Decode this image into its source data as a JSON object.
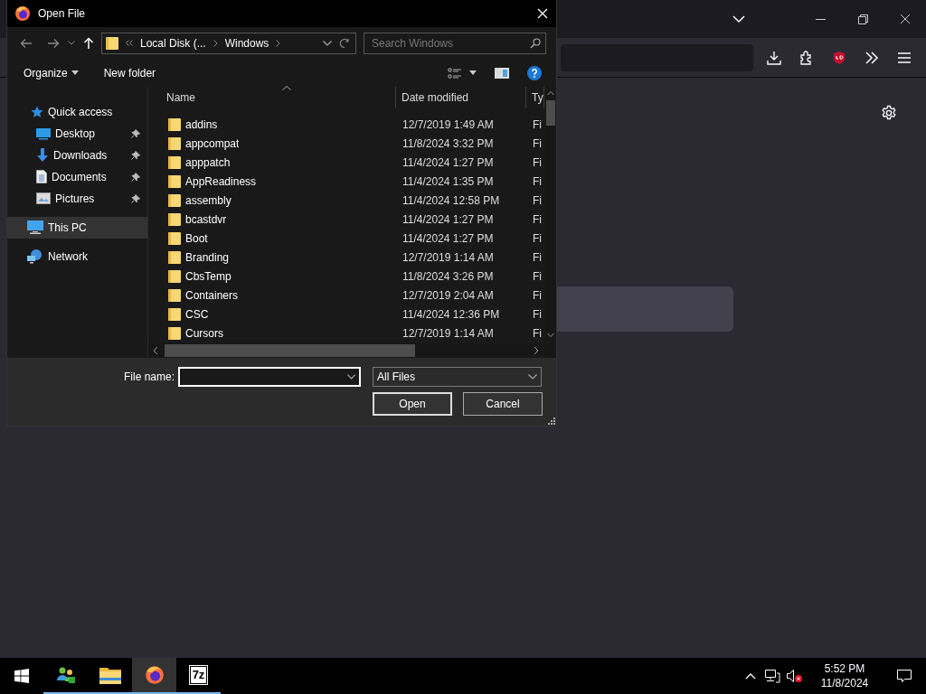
{
  "dialog": {
    "title": "Open File",
    "breadcrumb": [
      "Local Disk (...",
      "Windows"
    ],
    "search": {
      "placeholder": "Search Windows"
    },
    "toolbar": {
      "organize": "Organize",
      "new_folder": "New folder"
    },
    "nav": [
      {
        "label": "Quick access",
        "kind": "quick",
        "selected": false,
        "children": [
          {
            "label": "Desktop",
            "kind": "desktop",
            "selected": false,
            "pinned": true
          },
          {
            "label": "Downloads",
            "kind": "downloads",
            "selected": false,
            "pinned": true
          },
          {
            "label": "Documents",
            "kind": "documents",
            "selected": false,
            "pinned": true
          },
          {
            "label": "Pictures",
            "kind": "pictures",
            "selected": false,
            "pinned": true
          }
        ]
      },
      {
        "label": "This PC",
        "kind": "pc",
        "selected": true
      },
      {
        "label": "Network",
        "kind": "network",
        "selected": false
      }
    ],
    "columns": [
      "Name",
      "Date modified",
      "Ty"
    ],
    "rows": [
      {
        "name": "addins",
        "date": "12/7/2019 1:49 AM",
        "column_3": "Fi"
      },
      {
        "name": "appcompat",
        "date": "11/8/2024 3:32 PM",
        "column_3": "Fi"
      },
      {
        "name": "apppatch",
        "date": "11/4/2024 1:27 PM",
        "column_3": "Fi"
      },
      {
        "name": "AppReadiness",
        "date": "11/4/2024 1:35 PM",
        "column_3": "Fi"
      },
      {
        "name": "assembly",
        "date": "11/4/2024 12:58 PM",
        "column_3": "Fi"
      },
      {
        "name": "bcastdvr",
        "date": "11/4/2024 1:27 PM",
        "column_3": "Fi"
      },
      {
        "name": "Boot",
        "date": "11/4/2024 1:27 PM",
        "column_3": "Fi"
      },
      {
        "name": "Branding",
        "date": "12/7/2019 1:14 AM",
        "column_3": "Fi"
      },
      {
        "name": "CbsTemp",
        "date": "11/8/2024 3:26 PM",
        "column_3": "Fi"
      },
      {
        "name": "Containers",
        "date": "12/7/2019 2:04 AM",
        "column_3": "Fi"
      },
      {
        "name": "CSC",
        "date": "11/4/2024 12:36 PM",
        "column_3": "Fi"
      },
      {
        "name": "Cursors",
        "date": "12/7/2019 1:14 AM",
        "column_3": "Fi"
      }
    ],
    "file_name": {
      "label": "File name:"
    },
    "file_type": "All Files",
    "buttons": [
      "Open",
      "Cancel"
    ]
  },
  "taskbar": {
    "apps": [
      {
        "kind": "people",
        "selected": false,
        "running": true
      },
      {
        "kind": "explorer",
        "selected": false,
        "running": true
      },
      {
        "kind": "firefox",
        "selected": true,
        "running": true
      },
      {
        "kind": "sevenzip",
        "label": "7z",
        "selected": false,
        "running": true
      }
    ],
    "clock": {
      "time": "5:52 PM",
      "date": "11/8/2024"
    }
  }
}
